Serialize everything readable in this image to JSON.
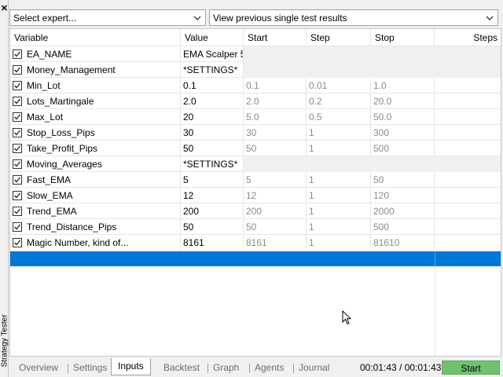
{
  "window": {
    "side_label": "Strategy Tester"
  },
  "top_bar": {
    "expert_select_value": "Select expert...",
    "results_select_value": "View previous single test results"
  },
  "table": {
    "columns": {
      "variable": "Variable",
      "value": "Value",
      "start": "Start",
      "step": "Step",
      "stop": "Stop",
      "steps": "Steps"
    },
    "rows": [
      {
        "name": "EA_NAME",
        "value": "EMA Scalper 5",
        "start": "",
        "step": "",
        "stop": "",
        "steps": "",
        "group": true
      },
      {
        "name": "Money_Management",
        "value": "*SETTINGS*",
        "start": "",
        "step": "",
        "stop": "",
        "steps": "",
        "group": true
      },
      {
        "name": "Min_Lot",
        "value": "0.1",
        "start": "0.1",
        "step": "0.01",
        "stop": "1.0",
        "steps": "",
        "group": false
      },
      {
        "name": "Lots_Martingale",
        "value": "2.0",
        "start": "2.0",
        "step": "0.2",
        "stop": "20.0",
        "steps": "",
        "group": false
      },
      {
        "name": "Max_Lot",
        "value": "20",
        "start": "5.0",
        "step": "0.5",
        "stop": "50.0",
        "steps": "",
        "group": false
      },
      {
        "name": "Stop_Loss_Pips",
        "value": "30",
        "start": "30",
        "step": "1",
        "stop": "300",
        "steps": "",
        "group": false
      },
      {
        "name": "Take_Profit_Pips",
        "value": "50",
        "start": "50",
        "step": "1",
        "stop": "500",
        "steps": "",
        "group": false
      },
      {
        "name": "Moving_Averages",
        "value": "*SETTINGS*",
        "start": "",
        "step": "",
        "stop": "",
        "steps": "",
        "group": true
      },
      {
        "name": "Fast_EMA",
        "value": "5",
        "start": "5",
        "step": "1",
        "stop": "50",
        "steps": "",
        "group": false
      },
      {
        "name": "Slow_EMA",
        "value": "12",
        "start": "12",
        "step": "1",
        "stop": "120",
        "steps": "",
        "group": false
      },
      {
        "name": "Trend_EMA",
        "value": "200",
        "start": "200",
        "step": "1",
        "stop": "2000",
        "steps": "",
        "group": false
      },
      {
        "name": "Trend_Distance_Pips",
        "value": "50",
        "start": "50",
        "step": "1",
        "stop": "500",
        "steps": "",
        "group": false
      },
      {
        "name": "Magic Number, kind of...",
        "value": "8161",
        "start": "8161",
        "step": "1",
        "stop": "81610",
        "steps": "",
        "group": false
      }
    ]
  },
  "tabs": [
    {
      "label": "Overview",
      "active": false
    },
    {
      "label": "Settings",
      "active": false
    },
    {
      "label": "Inputs",
      "active": true
    },
    {
      "label": "Backtest",
      "active": false
    },
    {
      "label": "Graph",
      "active": false
    },
    {
      "label": "Agents",
      "active": false
    },
    {
      "label": "Journal",
      "active": false
    }
  ],
  "status": {
    "timer": "00:01:43 / 00:01:43",
    "start_label": "Start"
  },
  "colors": {
    "selection": "#0078d7",
    "start_button": "#70c170"
  },
  "icons": {
    "close": "close-icon",
    "dropdown": "chevron-down-icon",
    "checkbox": "checkbox-checked-icon",
    "cursor": "mouse-pointer-icon"
  }
}
